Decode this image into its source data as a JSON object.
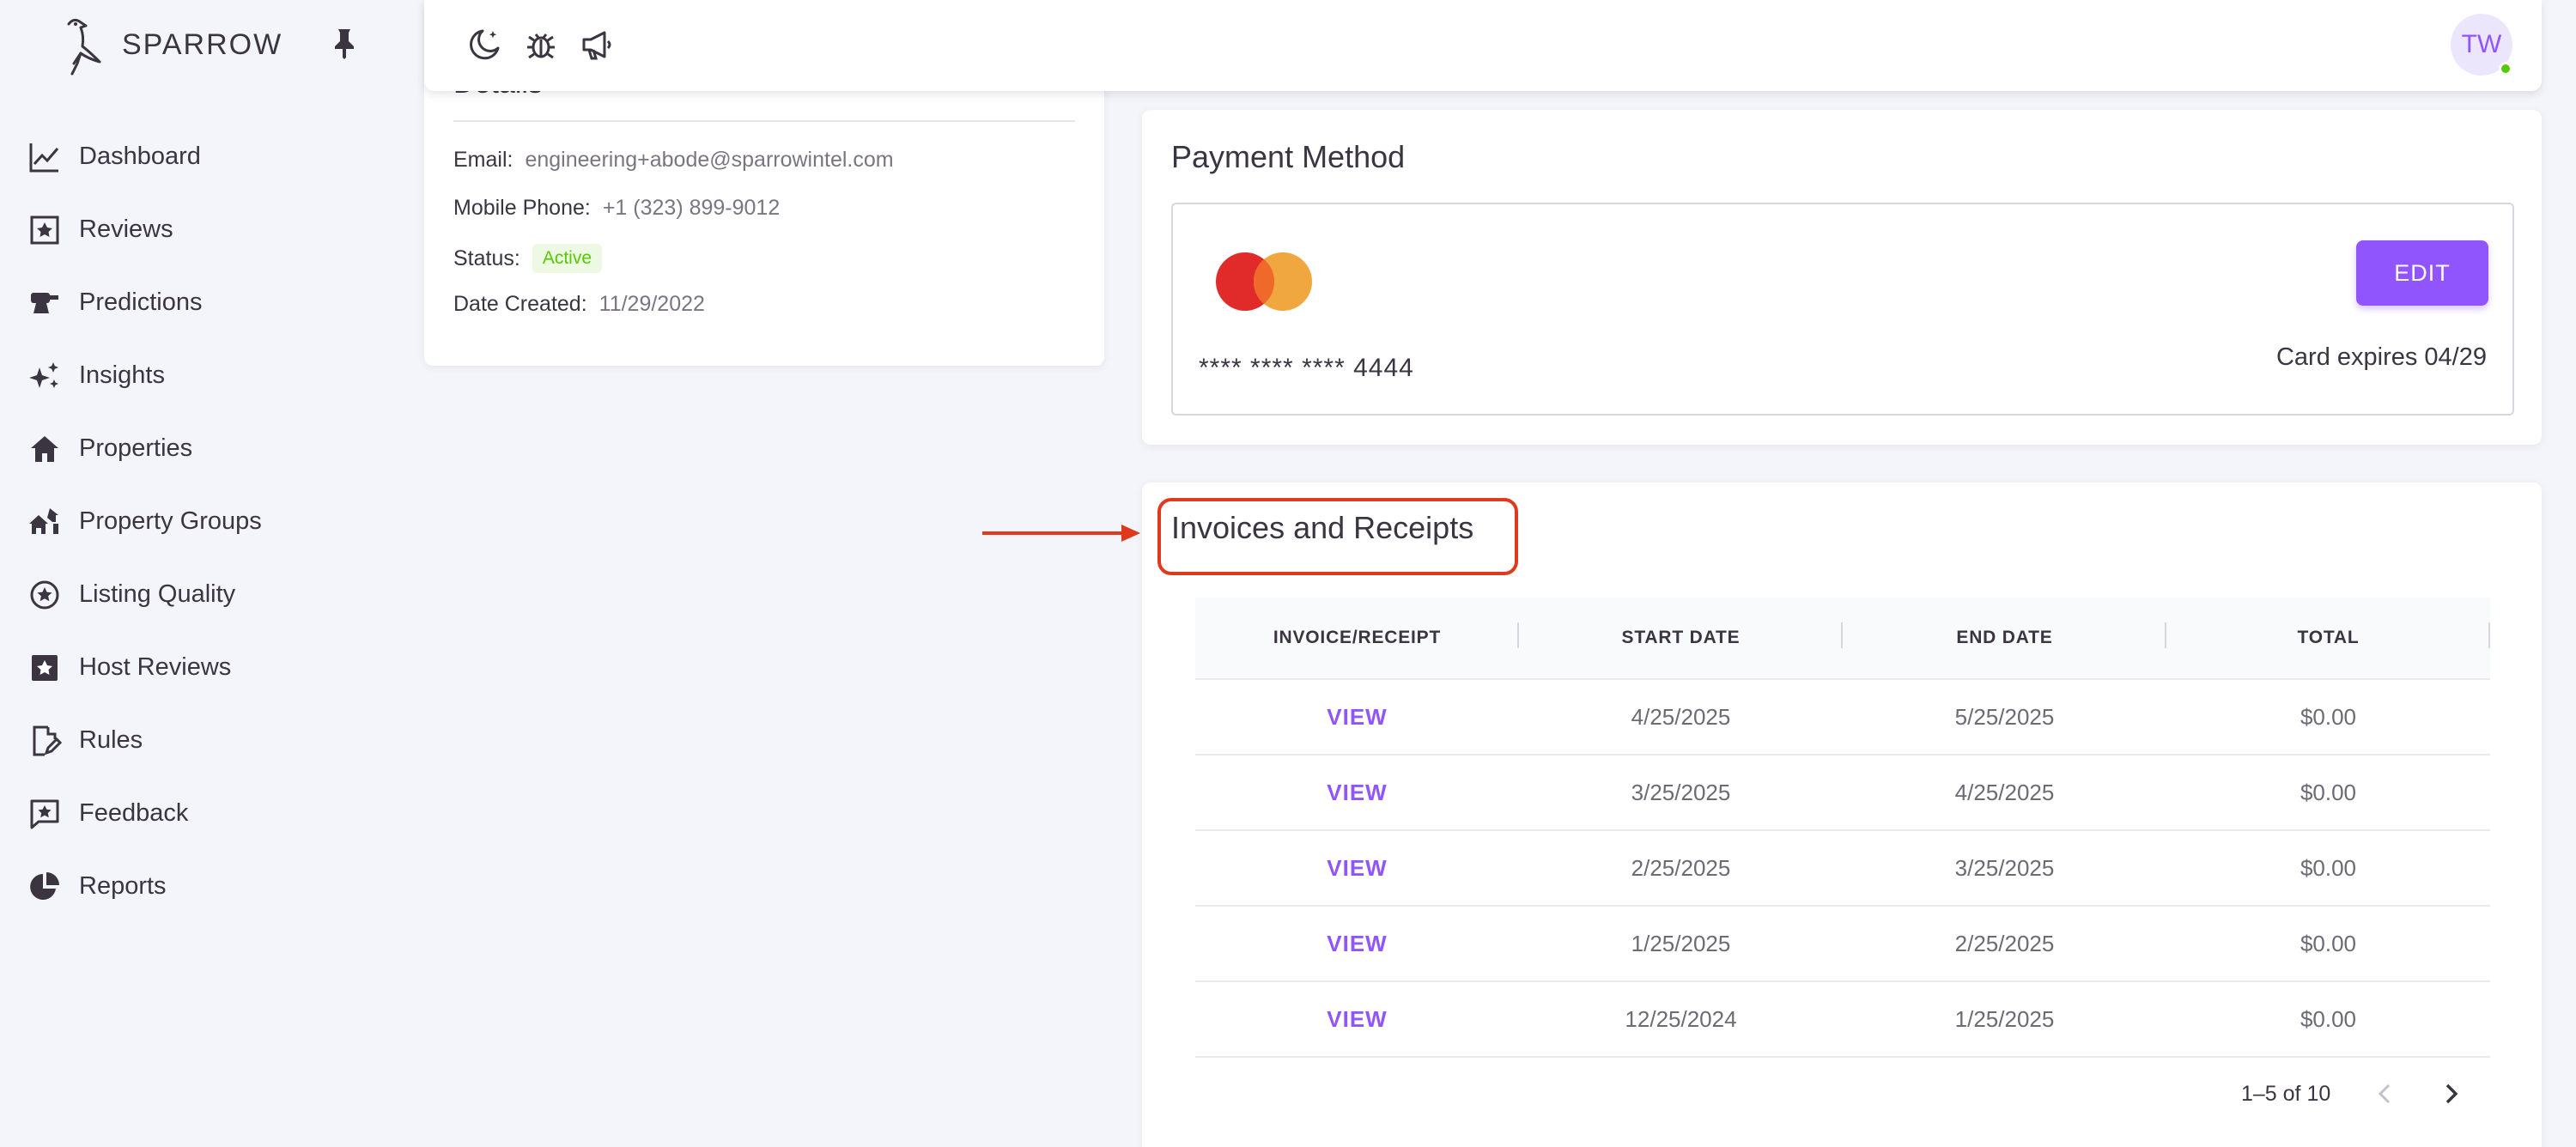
{
  "brand": {
    "name": "SPARROW"
  },
  "sidebar": {
    "items": [
      {
        "label": "Dashboard",
        "icon": "chart-line-icon"
      },
      {
        "label": "Reviews",
        "icon": "star-box-icon"
      },
      {
        "label": "Predictions",
        "icon": "crystal-ball-icon"
      },
      {
        "label": "Insights",
        "icon": "sparkles-icon"
      },
      {
        "label": "Properties",
        "icon": "home-icon"
      },
      {
        "label": "Property Groups",
        "icon": "home-group-icon"
      },
      {
        "label": "Listing Quality",
        "icon": "star-circle-icon"
      },
      {
        "label": "Host Reviews",
        "icon": "star-box-filled-icon"
      },
      {
        "label": "Rules",
        "icon": "file-edit-icon"
      },
      {
        "label": "Feedback",
        "icon": "message-star-icon"
      },
      {
        "label": "Reports",
        "icon": "chart-pie-icon"
      }
    ]
  },
  "topbar": {
    "avatar_initials": "TW"
  },
  "details": {
    "title": "Details",
    "email_label": "Email:",
    "email": "engineering+abode@sparrowintel.com",
    "phone_label": "Mobile Phone:",
    "phone": "+1 (323) 899-9012",
    "status_label": "Status:",
    "status": "Active",
    "created_label": "Date Created:",
    "created": "11/29/2022"
  },
  "payment": {
    "title": "Payment Method",
    "card_number": "**** **** **** 4444",
    "edit_label": "EDIT",
    "expires": "Card expires 04/29"
  },
  "invoices": {
    "title": "Invoices and Receipts",
    "columns": [
      "INVOICE/RECEIPT",
      "START DATE",
      "END DATE",
      "TOTAL"
    ],
    "rows": [
      {
        "link": "VIEW",
        "start": "4/25/2025",
        "end": "5/25/2025",
        "total": "$0.00"
      },
      {
        "link": "VIEW",
        "start": "3/25/2025",
        "end": "4/25/2025",
        "total": "$0.00"
      },
      {
        "link": "VIEW",
        "start": "2/25/2025",
        "end": "3/25/2025",
        "total": "$0.00"
      },
      {
        "link": "VIEW",
        "start": "1/25/2025",
        "end": "2/25/2025",
        "total": "$0.00"
      },
      {
        "link": "VIEW",
        "start": "12/25/2024",
        "end": "1/25/2025",
        "total": "$0.00"
      }
    ],
    "pagination": "1–5 of 10"
  },
  "colors": {
    "accent": "#9155fd",
    "success": "#56ca00",
    "highlight": "#e03a1e"
  }
}
